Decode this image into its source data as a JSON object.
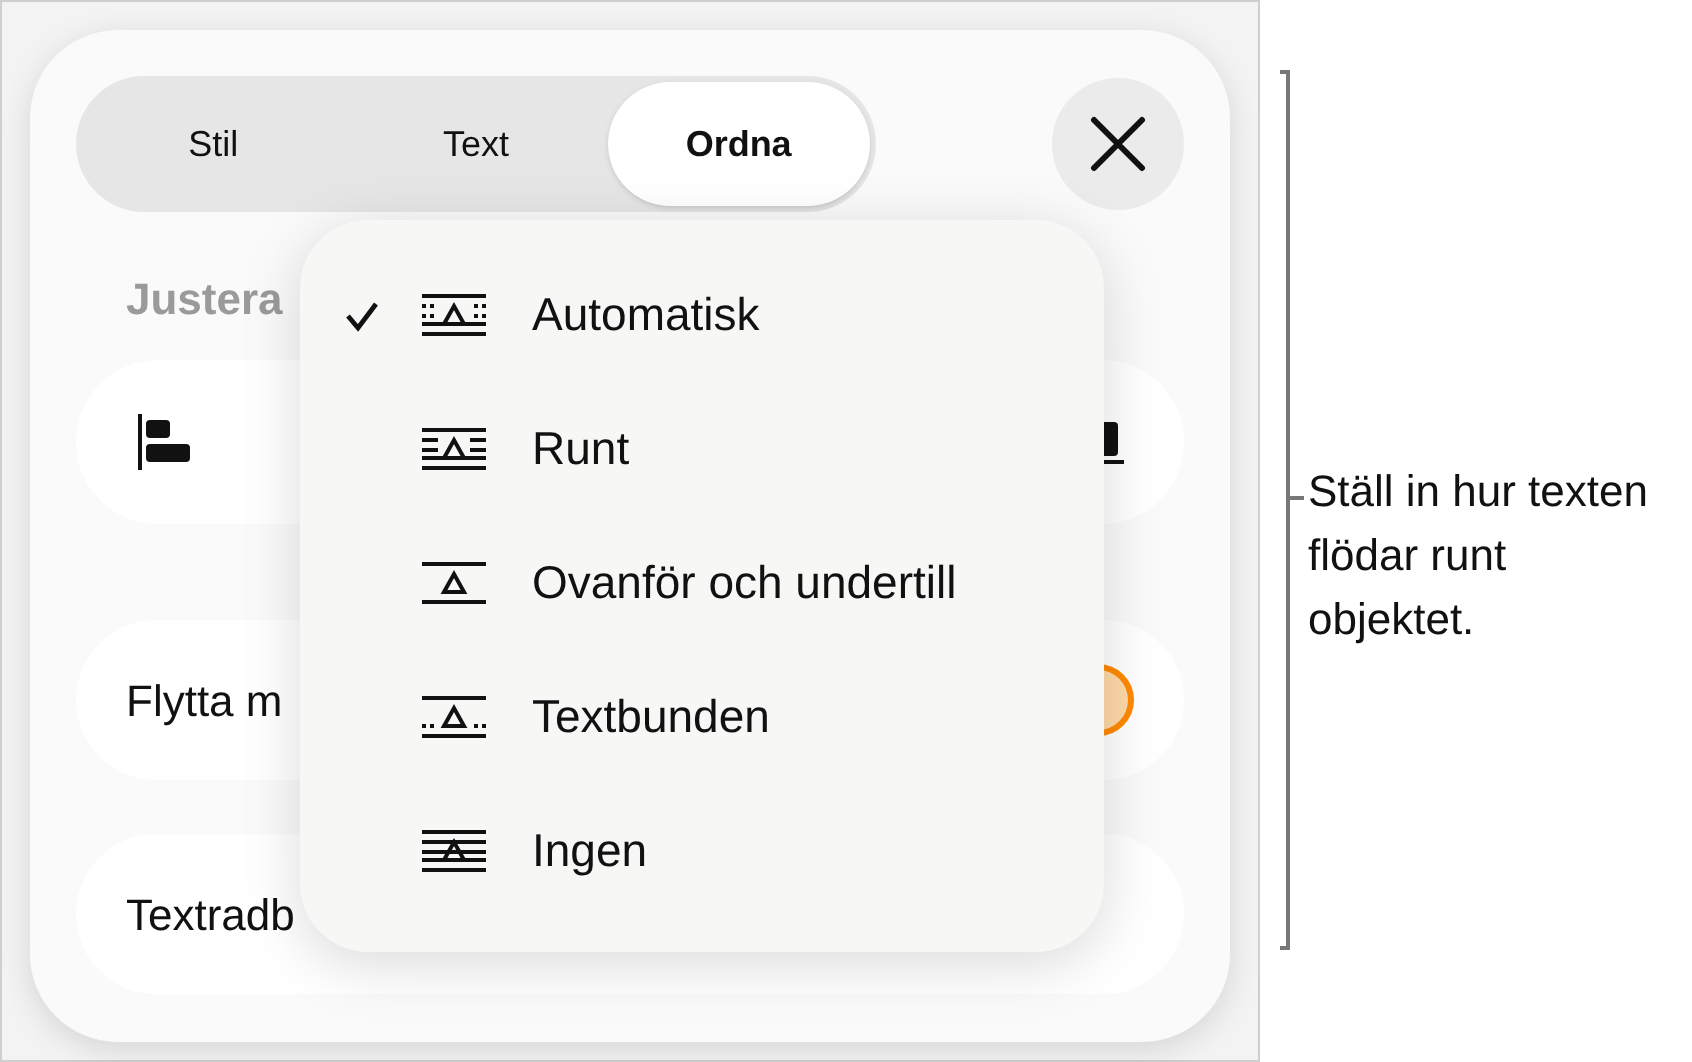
{
  "tabs": [
    {
      "label": "Stil",
      "selected": false
    },
    {
      "label": "Text",
      "selected": false
    },
    {
      "label": "Ordna",
      "selected": true
    }
  ],
  "section_label": "Justera",
  "rows": [
    {
      "label": "Flytta m",
      "toggle_on": true
    },
    {
      "label": "Textradb"
    }
  ],
  "wrap_menu": [
    {
      "kind": "automatic",
      "label": "Automatisk",
      "checked": true
    },
    {
      "kind": "around",
      "label": "Runt",
      "checked": false
    },
    {
      "kind": "above_below",
      "label": "Ovanför och undertill",
      "checked": false
    },
    {
      "kind": "inline",
      "label": "Textbunden",
      "checked": false
    },
    {
      "kind": "none",
      "label": "Ingen",
      "checked": false
    }
  ],
  "callout": "Ställ in hur texten flödar runt objektet."
}
